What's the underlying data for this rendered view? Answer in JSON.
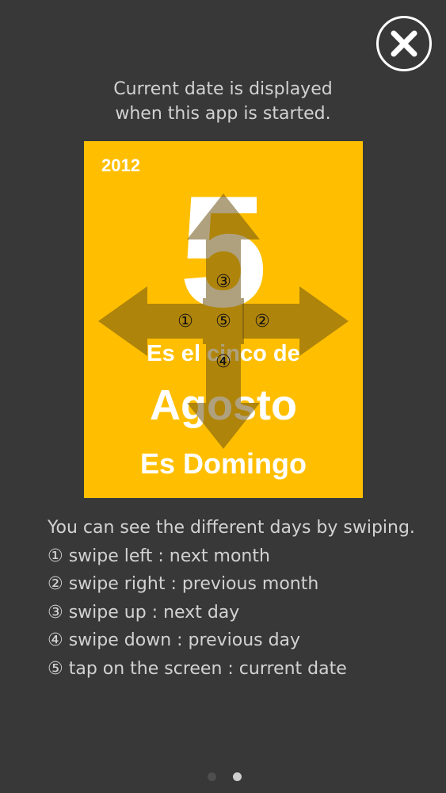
{
  "intro": {
    "line1": "Current date is displayed",
    "line2": "when this app is started."
  },
  "close_icon": "close-icon",
  "card": {
    "year": "2012",
    "day_number": "5",
    "line1": "Es el cinco de",
    "month": "Agosto",
    "weekday": "Es Domingo",
    "background_color": "#ffbf00",
    "markers": {
      "up": "③",
      "left": "①",
      "center": "⑤",
      "right": "②",
      "down": "④"
    }
  },
  "instructions": {
    "heading": "You can see the different days by swiping.",
    "items": [
      "① swipe left : next month",
      "② swipe right : previous month",
      "③ swipe up : next day",
      "④ swipe down : previous day",
      "⑤ tap on the screen : current date"
    ]
  },
  "pagination": {
    "total": 2,
    "active": 2
  }
}
